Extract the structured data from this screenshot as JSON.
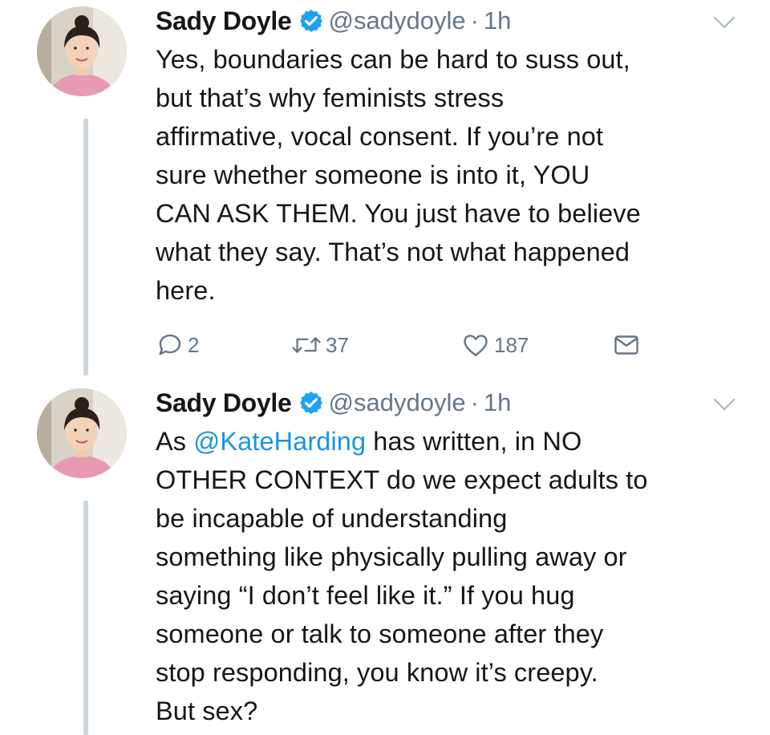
{
  "tweets": [
    {
      "author": {
        "name": "Sady Doyle",
        "handle": "@sadydoyle",
        "verified": true
      },
      "separator": "·",
      "time": "1h",
      "lines": [
        "Yes, boundaries can be hard to suss out,",
        "but that’s why feminists stress",
        "affirmative, vocal consent. If you’re not",
        "sure whether someone is into it, YOU",
        "CAN ASK THEM. You just have to believe",
        "what they say. That’s not what happened",
        "here."
      ],
      "actions": {
        "replies": "2",
        "retweets": "37",
        "likes": "187"
      }
    },
    {
      "author": {
        "name": "Sady Doyle",
        "handle": "@sadydoyle",
        "verified": true
      },
      "separator": "·",
      "time": "1h",
      "first_line": {
        "prefix": "As ",
        "mention": "@KateHarding",
        "suffix": " has written, in NO"
      },
      "lines": [
        "OTHER CONTEXT do we expect adults to",
        "be incapable of understanding",
        "something like physically pulling away or",
        "saying “I don’t feel like it.” If you hug",
        "someone or talk to someone after they",
        "stop responding, you know it’s creepy.",
        "But sex?"
      ]
    }
  ],
  "colors": {
    "text": "#14171a",
    "secondary": "#657786",
    "link": "#1b95e0",
    "verified": "#1da1f2",
    "thread_line": "#ccd6dd"
  },
  "icons": [
    "verified-badge-icon",
    "chevron-down-icon",
    "reply-icon",
    "retweet-icon",
    "heart-icon",
    "envelope-icon"
  ]
}
